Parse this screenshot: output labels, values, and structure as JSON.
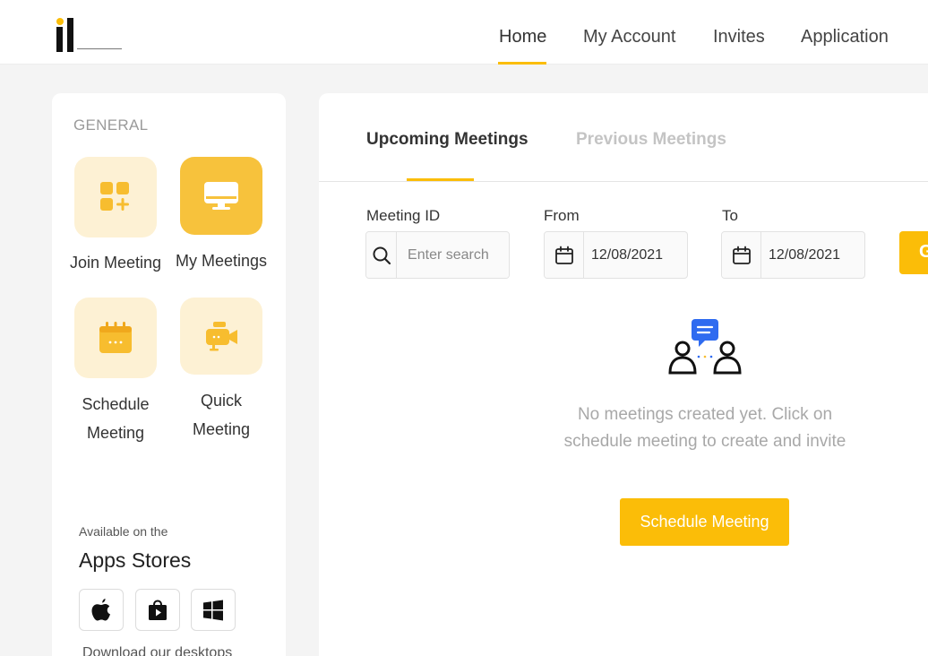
{
  "nav": {
    "items": [
      {
        "label": "Home",
        "active": true
      },
      {
        "label": "My Account",
        "active": false
      },
      {
        "label": "Invites",
        "active": false
      },
      {
        "label": "Application",
        "active": false
      }
    ]
  },
  "sidebar": {
    "section_title": "GENERAL",
    "tiles": [
      {
        "label": "Join Meeting",
        "icon": "join-meeting-icon"
      },
      {
        "label": "My Meetings",
        "icon": "monitor-icon",
        "active": true
      },
      {
        "label_line1": "Schedule",
        "label_line2": "Meeting",
        "icon": "calendar-icon"
      },
      {
        "label_line1": "Quick",
        "label_line2": "Meeting",
        "icon": "video-camera-icon"
      }
    ],
    "apps_available": "Available on the",
    "apps_title": "Apps Stores",
    "stores": [
      "apple-icon",
      "play-store-icon",
      "windows-icon"
    ],
    "download_text": "Download our desktops"
  },
  "main": {
    "tabs": [
      {
        "label": "Upcoming Meetings",
        "active": true
      },
      {
        "label": "Previous Meetings",
        "active": false
      }
    ],
    "filters": {
      "meeting_id_label": "Meeting ID",
      "meeting_id_placeholder": "Enter search",
      "from_label": "From",
      "from_value": "12/08/2021",
      "to_label": "To",
      "to_value": "12/08/2021"
    },
    "empty_message": "No meetings created yet. Click on schedule meeting to create and invite",
    "schedule_button": "Schedule Meeting"
  },
  "colors": {
    "accent": "#fbbd08",
    "tile_bg": "#fdf1d4",
    "tile_active_bg": "#f7c23c",
    "chat_bubble": "#2f6bf0"
  }
}
